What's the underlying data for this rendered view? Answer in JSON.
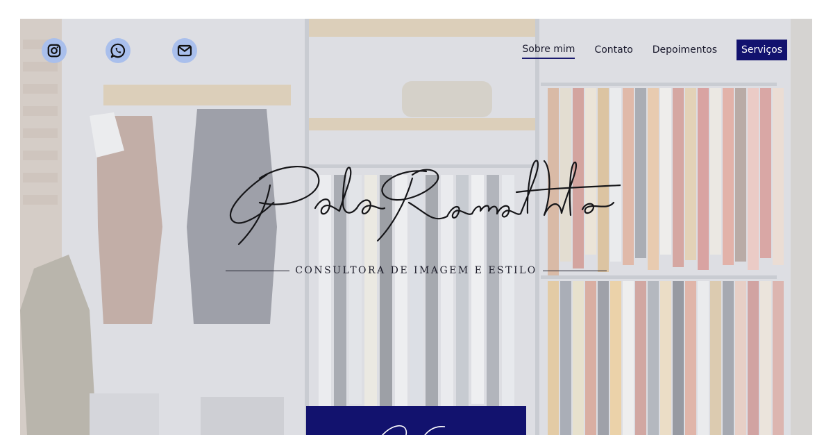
{
  "social": {
    "icons": [
      "instagram-icon",
      "whatsapp-icon",
      "mail-icon"
    ],
    "bubble_color": "#a9bfec"
  },
  "nav": {
    "items": [
      {
        "label": "Sobre mim",
        "active": true
      },
      {
        "label": "Contato",
        "active": false
      },
      {
        "label": "Depoimentos",
        "active": false
      },
      {
        "label": "Serviços",
        "active": false
      }
    ]
  },
  "hero": {
    "logo_script": "Paola Ramalhete",
    "tagline": "CONSULTORA DE IMAGEM E ESTILO"
  },
  "colors": {
    "brand_navy": "#12126e",
    "text_dark": "#1a1a2e"
  }
}
